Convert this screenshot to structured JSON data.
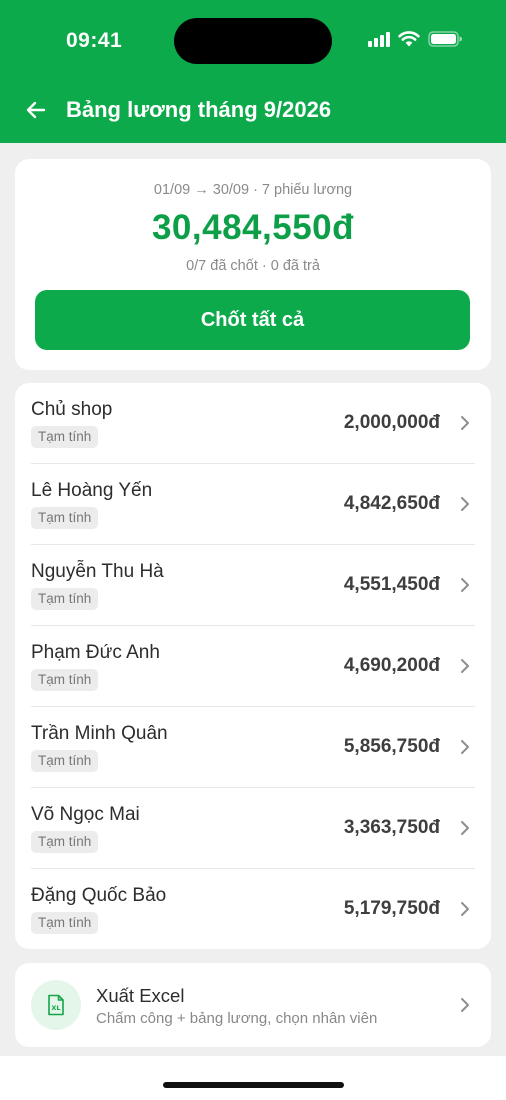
{
  "status_bar": {
    "time": "09:41"
  },
  "header": {
    "title": "Bảng lương tháng 9/2026"
  },
  "summary": {
    "range": "01/09 → 30/09 · 7 phiếu lương",
    "total": "30,484,550đ",
    "progress": "0/7 đã chốt · 0 đã trả",
    "confirm_all": "Chốt tất cả"
  },
  "payslips": [
    {
      "name": "Chủ shop",
      "status": "Tạm tính",
      "amount": "2,000,000đ"
    },
    {
      "name": "Lê Hoàng Yến",
      "status": "Tạm tính",
      "amount": "4,842,650đ"
    },
    {
      "name": "Nguyễn Thu Hà",
      "status": "Tạm tính",
      "amount": "4,551,450đ"
    },
    {
      "name": "Phạm Đức Anh",
      "status": "Tạm tính",
      "amount": "4,690,200đ"
    },
    {
      "name": "Trần Minh Quân",
      "status": "Tạm tính",
      "amount": "5,856,750đ"
    },
    {
      "name": "Võ Ngọc Mai",
      "status": "Tạm tính",
      "amount": "3,363,750đ"
    },
    {
      "name": "Đặng Quốc Bảo",
      "status": "Tạm tính",
      "amount": "5,179,750đ"
    }
  ],
  "export": {
    "icon": "excel-file-icon",
    "title": "Xuất Excel",
    "subtitle": "Chấm công + bảng lương, chọn nhân viên"
  },
  "colors": {
    "brand_green": "#0daa4c",
    "total_green": "#0d9e48",
    "background": "#efefef"
  }
}
